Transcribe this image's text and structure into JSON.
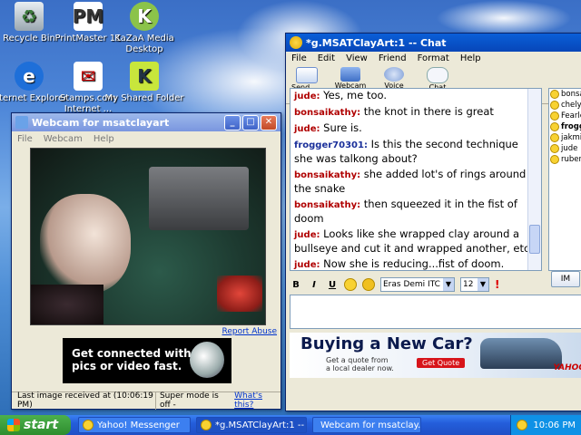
{
  "desktop": {
    "icons": [
      {
        "label": "Recycle Bin"
      },
      {
        "label": "PrintMaster 11"
      },
      {
        "label": "KaZaA Media Desktop"
      },
      {
        "label": "Internet Explorer"
      },
      {
        "label": "Stamps.com Internet ..."
      },
      {
        "label": "My Shared Folder"
      }
    ]
  },
  "webcam_window": {
    "title": "Webcam for msatclayart",
    "menu": [
      "File",
      "Webcam",
      "Help"
    ],
    "report_abuse": "Report Abuse",
    "ad_line1": "Get connected with",
    "ad_line2": "pics or video fast.",
    "status_left": "Last image received at (10:06:19 PM)",
    "status_mode": "Super mode is off -",
    "status_link": "What's this?"
  },
  "chat_window": {
    "title": "*g.MSATClayArt:1 -- Chat",
    "menu": [
      "File",
      "Edit",
      "View",
      "Friend",
      "Format",
      "Help"
    ],
    "toolbar": [
      {
        "label": "Send File"
      },
      {
        "label": "Webcam"
      },
      {
        "label": "Voice"
      },
      {
        "label": "Chat"
      }
    ],
    "messages": [
      {
        "nick": "jude:",
        "text": " Yes, me too.",
        "color": "red"
      },
      {
        "nick": "bonsaikathy:",
        "text": " the knot in there is great",
        "color": "red"
      },
      {
        "nick": "jude:",
        "text": " Sure is.",
        "color": "red"
      },
      {
        "nick": "frogger70301:",
        "text": " Is this the second technique she was talkong about?",
        "color": "blue"
      },
      {
        "nick": "bonsaikathy:",
        "text": " she added lot's of rings around the snake",
        "color": "red"
      },
      {
        "nick": "bonsaikathy:",
        "text": " then squeezed it in the fist of doom",
        "color": "red"
      },
      {
        "nick": "jude:",
        "text": " Looks like she wrapped clay around a bullseye and cut it and wrapped another, etc.",
        "color": "red"
      },
      {
        "nick": "jude:",
        "text": " Now she is reducing...fist of doom.",
        "color": "red"
      }
    ],
    "buddies": [
      "bonsa",
      "chelyh",
      "Fearle",
      "frogg",
      "jakmia",
      "jude",
      "rubens"
    ],
    "im_button": "IM",
    "format": {
      "bold": "B",
      "italic": "I",
      "underline": "U",
      "font": "Eras Demi ITC",
      "size": "12"
    },
    "ad": {
      "headline": "Buying a New Car?",
      "sub1": "Get a quote from",
      "sub2": "a local dealer now.",
      "cta": "Get Quote",
      "brand": "YAHOO"
    }
  },
  "taskbar": {
    "start": "start",
    "tasks": [
      "Yahoo! Messenger",
      "*g.MSATClayArt:1 -- ...",
      "Webcam for msatclay..."
    ],
    "clock": "10:06 PM"
  },
  "colors": {
    "nick_red": "#b00000",
    "nick_blue": "#1a2f9a",
    "title_active": "#0a5fd8"
  }
}
